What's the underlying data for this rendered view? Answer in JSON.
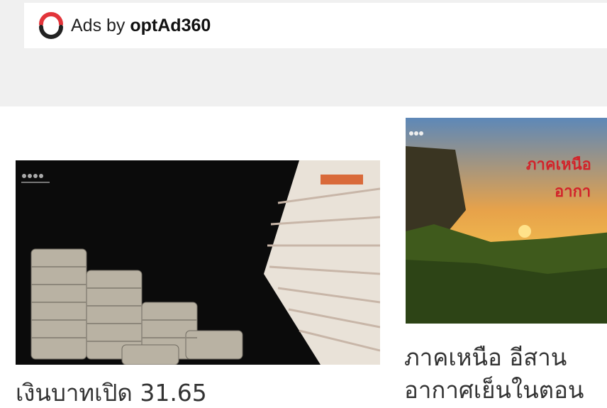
{
  "ad_banner": {
    "prefix": "Ads by ",
    "brand": "optAd360",
    "logo_icon": "optad360-logo-icon",
    "accent_color": "#e2343a"
  },
  "articles": [
    {
      "thumbnail_icon": "money-coins-banknotes-image",
      "title": "เงินบาทเปิด 31.65",
      "watermark": "ฐานเศรษฐกิจ"
    },
    {
      "thumbnail_icon": "mountain-sunset-image",
      "image_overlay_text_1": "ภาคเหนือ",
      "image_overlay_text_2": "อากา",
      "title_line_1": "ภาคเหนือ อีสาน",
      "title_line_2": "อากาศเย็นในตอน"
    }
  ]
}
